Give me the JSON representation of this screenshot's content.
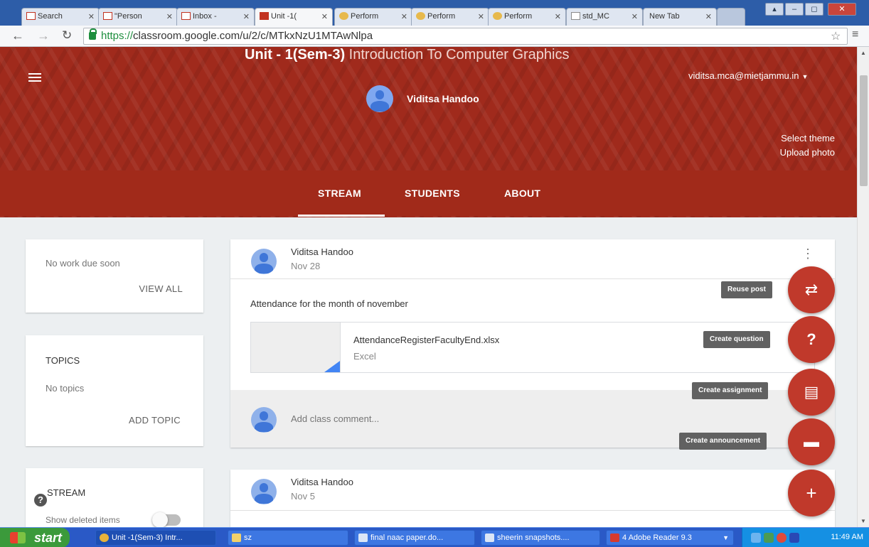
{
  "browser": {
    "tabs": [
      {
        "label": "Search",
        "icon": "gmail-icon"
      },
      {
        "label": "\"Person",
        "icon": "gmail-icon"
      },
      {
        "label": "Inbox -",
        "icon": "gmail-icon"
      },
      {
        "label": "Unit -1(",
        "icon": "classroom-icon",
        "active": true
      },
      {
        "label": "Perform",
        "icon": "page-icon"
      },
      {
        "label": "Perform",
        "icon": "page-icon"
      },
      {
        "label": "Perform",
        "icon": "page-icon"
      },
      {
        "label": "std_MC",
        "icon": "document-icon"
      },
      {
        "label": "New Tab",
        "icon": ""
      }
    ],
    "url_scheme": "https://",
    "url_rest": "classroom.google.com/u/2/c/MTkxNzU1MTAwNlpa"
  },
  "banner": {
    "class_title_bold": "Unit - 1(Sem-3)",
    "class_title_rest": " Introduction To Computer Graphics",
    "teacher": "Viditsa Handoo",
    "account": "viditsa.mca@mietjammu.in",
    "select_theme": "Select theme",
    "upload_photo": "Upload photo",
    "color": "#a12a1a"
  },
  "nav_tabs": [
    {
      "label": "STREAM",
      "selected": true
    },
    {
      "label": "STUDENTS"
    },
    {
      "label": "ABOUT"
    }
  ],
  "sidebar": {
    "upcoming_text": "No work due soon",
    "view_all": "VIEW ALL",
    "topics_heading": "TOPICS",
    "no_topics": "No topics",
    "add_topic": "ADD TOPIC",
    "stream_heading": "STREAM",
    "show_deleted": "Show deleted items",
    "show_deleted_on": false
  },
  "posts": [
    {
      "author": "Viditsa Handoo",
      "date": "Nov 28",
      "text": "Attendance for the month of november",
      "attachment": {
        "name": "AttendanceRegisterFacultyEnd.xlsx",
        "type": "Excel"
      },
      "comment_placeholder": "Add class comment..."
    },
    {
      "author": "Viditsa Handoo",
      "date": "Nov 5"
    }
  ],
  "fab_actions": [
    {
      "label": "Reuse post",
      "icon": "reuse-icon"
    },
    {
      "label": "Create question",
      "icon": "question-icon"
    },
    {
      "label": "Create assignment",
      "icon": "assignment-icon"
    },
    {
      "label": "Create announcement",
      "icon": "announcement-icon"
    }
  ],
  "fab_color": "#c0392b",
  "taskbar": {
    "start": "start",
    "items": [
      {
        "label": "Unit -1(Sem-3) Intr...",
        "icon": "chrome-icon"
      },
      {
        "label": "sz",
        "icon": "folder-icon"
      },
      {
        "label": "final naac paper.do...",
        "icon": "word-icon"
      },
      {
        "label": "sheerin snapshots....",
        "icon": "word-icon"
      },
      {
        "label": "4 Adobe Reader 9.3",
        "icon": "adobe-icon"
      }
    ],
    "clock": "11:49 AM"
  }
}
